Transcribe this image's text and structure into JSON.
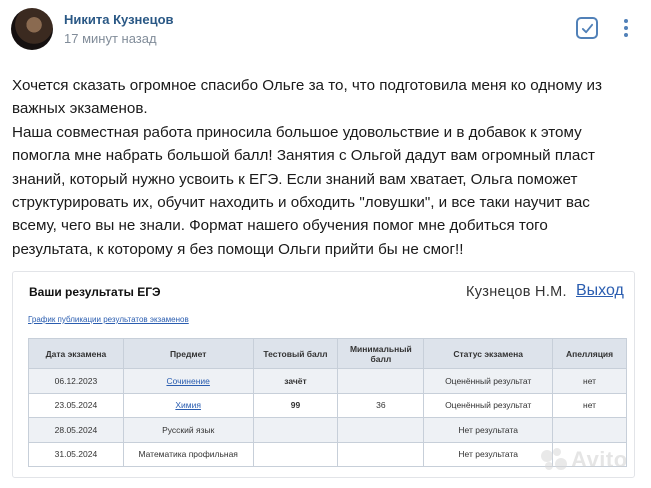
{
  "post": {
    "author": "Никита Кузнецов",
    "time": "17 минут назад",
    "text_lines": [
      "Хочется сказать огромное спасибо Ольге за то, что подготовила меня ко одному из",
      "важных экзаменов.",
      "Наша совместная работа приносила большое удовольствие и в добавок к этому",
      "помогла мне набрать большой балл! Занятия с Ольгой дадут вам огромный пласт",
      "знаний, который нужно усвоить к ЕГЭ. Если знаний вам хватает, Ольга поможет",
      "структурировать их, обучит находить и обходить \"ловушки\", и все таки научит вас",
      "всему, чего вы не знали. Формат нашего обучения помог мне добиться того",
      "результата, к которому я без помощи Ольги прийти бы не смог!!"
    ]
  },
  "results_card": {
    "title": "Ваши результаты ЕГЭ",
    "user_name": "Кузнецов Н.М.",
    "logout_label": "Выход",
    "schedule_link": "График публикации результатов экзаменов",
    "columns": [
      "Дата экзамена",
      "Предмет",
      "Тестовый балл",
      "Минимальный балл",
      "Статус экзамена",
      "Апелляция"
    ],
    "rows": [
      {
        "date": "06.12.2023",
        "subject": "Сочинение",
        "subject_link": true,
        "score": "зачёт",
        "min": "",
        "status": "Оценённый результат",
        "appeal": "нет"
      },
      {
        "date": "23.05.2024",
        "subject": "Химия",
        "subject_link": true,
        "score": "99",
        "min": "36",
        "status": "Оценённый результат",
        "appeal": "нет"
      },
      {
        "date": "28.05.2024",
        "subject": "Русский язык",
        "subject_link": false,
        "score": "",
        "min": "",
        "status": "Нет результата",
        "appeal": ""
      },
      {
        "date": "31.05.2024",
        "subject": "Математика профильная",
        "subject_link": false,
        "score": "",
        "min": "",
        "status": "Нет результата",
        "appeal": ""
      }
    ]
  },
  "watermark": {
    "text": "Avito"
  },
  "colors": {
    "link": "#2a5db0",
    "author": "#2a5885",
    "pass": "#2e8b2e",
    "header_bg": "#dde3eb"
  },
  "icons": [
    "avatar",
    "checkbox-icon",
    "more-options-icon",
    "avito-logo-icon"
  ]
}
